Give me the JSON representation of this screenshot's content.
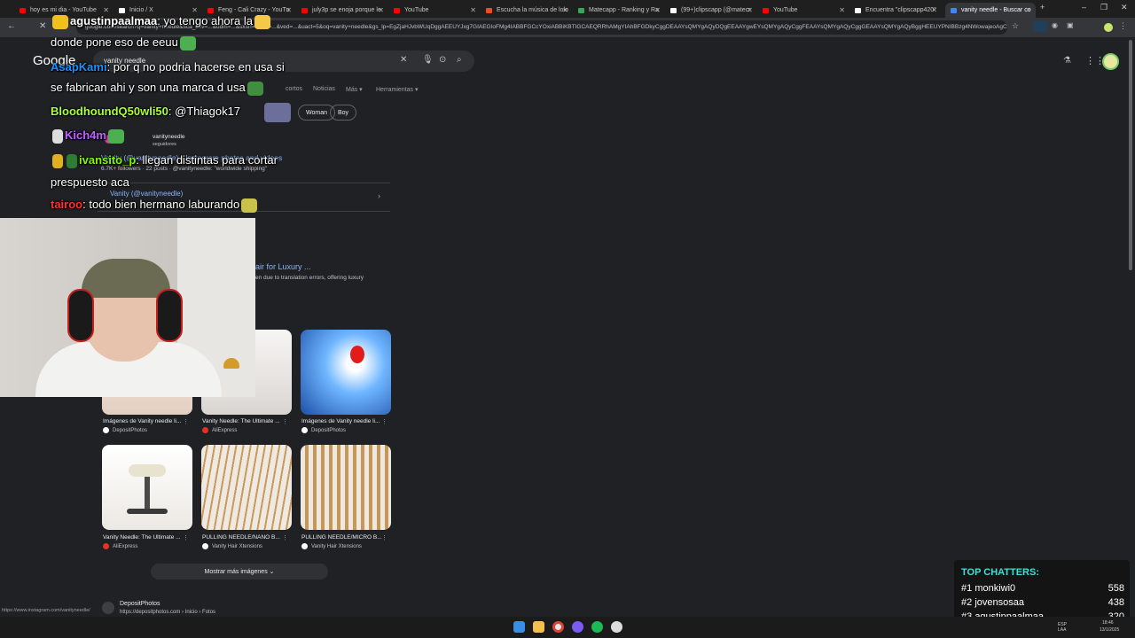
{
  "browser": {
    "tabs": [
      {
        "label": "hoy es mi dia - YouTube",
        "color": "#ff0000"
      },
      {
        "label": "Inicio / X",
        "color": "#ffffff"
      },
      {
        "label": "Feng - Cali Crazy - YouTu",
        "color": "#ff0000"
      },
      {
        "label": "july3p se enoja porque le",
        "color": "#ff0000"
      },
      {
        "label": "YouTube",
        "color": "#ff0000"
      },
      {
        "label": "Escucha la música de lolo",
        "color": "#f04c1d"
      },
      {
        "label": "Matecapp - Ranking y Ra",
        "color": "#34a853"
      },
      {
        "label": "(99+)clipscapp (@matecr",
        "color": "#ffffff"
      },
      {
        "label": "YouTube",
        "color": "#ff0000"
      },
      {
        "label": "Encuentra \"clipscapp420\"",
        "color": "#ffffff"
      },
      {
        "label": "vanity needle - Buscar co",
        "color": "#4285f4"
      }
    ],
    "new_tab": "+",
    "win_min": "–",
    "win_max": "❐",
    "win_close": "✕",
    "back": "←",
    "reload": "✕",
    "url": "google.com/search?q=vanity+needle&sca_esv=...&udm=...&sxsrf=...&ei=...&ved=...&uact=5&oq=vanity+needle&gs_lp=EgZjaHJvbWUqDggAEEUYJxg7GIAEGIoFMg4IABBFGCcYOxiABBiKBTIGCAEQRRhAMgYIAhBFGDkyCggDEAAYsQMYgAQyDQgEEAAYgwEYsQMYgAQyCggFEAAYsQMYgAQyCggGEAAYsQMYgAQyBggHEEUYPNIBBzg4NWowajeoAgCwAgA&sourceid=chro..."
  },
  "google": {
    "logo": "Google",
    "query": "vanity needle",
    "filters": [
      "cortos",
      "Noticias",
      "Más ▾",
      "Herramientas ▾"
    ],
    "chips": [
      "Woman",
      "Boy"
    ],
    "ig_name": "vanityneedle",
    "ig_followers": "seguidores",
    "ig_title": "Vanity (@vanityneedle) • Instagram photos and videos",
    "ig_stats": "6.7K+ followers · 22 posts · @vanityneedle: \"worldwide shipping\"",
    "vanity_link": "Vanity (@vanityneedle)",
    "luxury_title": "air for Luxury ...",
    "luxury_snippet": "en due to translation errors, offering luxury",
    "images": [
      {
        "caption": "Imágenes de Vanity needle li...",
        "source": "DepositPhotos",
        "src_color": "#ffffff"
      },
      {
        "caption": "Vanity Needle: The Ultimate ...",
        "source": "AliExpress",
        "src_color": "#e43225"
      },
      {
        "caption": "Imágenes de Vanity needle li...",
        "source": "DepositPhotos",
        "src_color": "#ffffff"
      },
      {
        "caption": "Vanity Needle: The Ultimate ...",
        "source": "AliExpress",
        "src_color": "#e43225"
      },
      {
        "caption": "PULLING NEEDLE/NANO B...",
        "source": "Vanity Hair Xtensions",
        "src_color": "#ffffff"
      },
      {
        "caption": "PULLING NEEDLE/MICRO B...",
        "source": "Vanity Hair Xtensions",
        "src_color": "#ffffff"
      }
    ],
    "more_images": "Mostrar más imágenes ⌄",
    "bottom_site": "DepositPhotos",
    "bottom_url": "https://depositphotos.com › Inicio › Fotos",
    "status_url": "https://www.instagram.com/vanityneedle/"
  },
  "chat": [
    {
      "user": "agustinpaalmaa",
      "color": "#ffffff",
      "text": ": yo tengo ahora la"
    },
    {
      "user": "",
      "color": "#ffffff",
      "text": "donde pone eso de eeuu"
    },
    {
      "user": "AsapKami",
      "color": "#1e90ff",
      "text": ": por q no podria hacerse en usa si"
    },
    {
      "user": "",
      "color": "#ffffff",
      "text": "se fabrican ahi y son una marca d usa"
    },
    {
      "user": "BloodhoundQ50wli50",
      "color": "#adff2f",
      "text": ": @Thiagok17"
    },
    {
      "user": "Kich4m",
      "color": "#c060ff",
      "text": ""
    },
    {
      "user": "ivansito_p",
      "color": "#7cfc00",
      "text": ": llegan distintas para cortar"
    },
    {
      "user": "",
      "color": "#ffffff",
      "text": "prespuesto aca"
    },
    {
      "user": "tairoo",
      "color": "#ff3030",
      "text": ": todo bien hermano laburando"
    }
  ],
  "top_chatters": {
    "title": "TOP CHATTERS:",
    "rows": [
      {
        "rank": "#1",
        "name": "monkiwi0",
        "count": "558"
      },
      {
        "rank": "#2",
        "name": "jovensosaa",
        "count": "438"
      },
      {
        "rank": "#3",
        "name": "agustinpaalmaa",
        "count": "320"
      }
    ]
  },
  "taskbar": {
    "lang": "ESP LAA",
    "time": "18:46",
    "date": "13/1/2025"
  }
}
